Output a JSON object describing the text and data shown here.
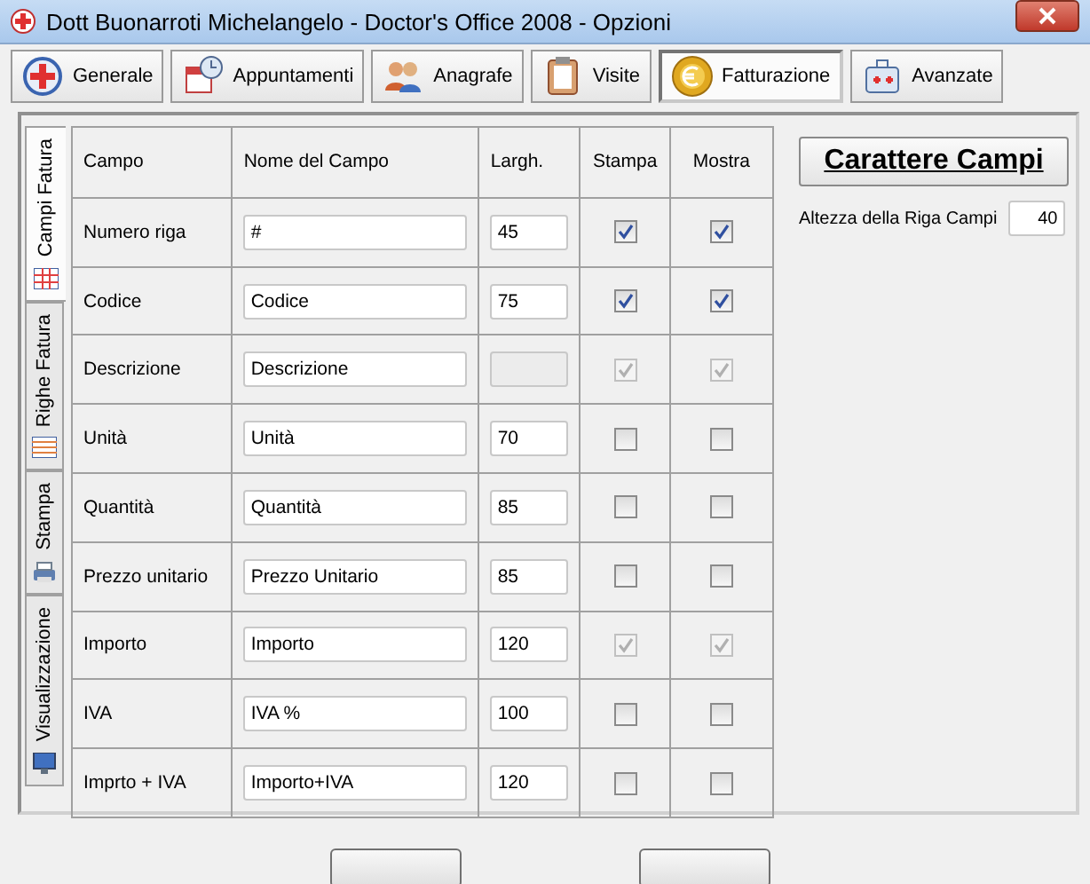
{
  "window": {
    "title": "Dott Buonarroti Michelangelo - Doctor's Office 2008 - Opzioni"
  },
  "toolbar": [
    {
      "label": "Generale",
      "selected": false
    },
    {
      "label": "Appuntamenti",
      "selected": false
    },
    {
      "label": "Anagrafe",
      "selected": false
    },
    {
      "label": "Visite",
      "selected": false
    },
    {
      "label": "Fatturazione",
      "selected": true
    },
    {
      "label": "Avanzate",
      "selected": false
    }
  ],
  "side_tabs": [
    {
      "label": "Campi Fatura",
      "selected": true
    },
    {
      "label": "Righe Fatura",
      "selected": false
    },
    {
      "label": "Stampa",
      "selected": false
    },
    {
      "label": "Visualizzazione",
      "selected": false
    }
  ],
  "table": {
    "columns": [
      "Campo",
      "Nome del Campo",
      "Largh.",
      "Stampa",
      "Mostra"
    ],
    "rows": [
      {
        "campo": "Numero riga",
        "nome": "#",
        "largh": "45",
        "largh_disabled": false,
        "stampa": true,
        "mostra": true,
        "disabled": false
      },
      {
        "campo": "Codice",
        "nome": "Codice",
        "largh": "75",
        "largh_disabled": false,
        "stampa": true,
        "mostra": true,
        "disabled": false
      },
      {
        "campo": "Descrizione",
        "nome": "Descrizione",
        "largh_disabled": true,
        "stampa": true,
        "mostra": true,
        "disabled": true
      },
      {
        "campo": "Unità",
        "nome": "Unità",
        "largh": "70",
        "largh_disabled": false,
        "stampa": false,
        "mostra": false,
        "disabled": false
      },
      {
        "campo": "Quantità",
        "nome": "Quantità",
        "largh": "85",
        "largh_disabled": false,
        "stampa": false,
        "mostra": false,
        "disabled": false
      },
      {
        "campo": "Prezzo unitario",
        "nome": "Prezzo Unitario",
        "largh": "85",
        "largh_disabled": false,
        "stampa": false,
        "mostra": false,
        "disabled": false
      },
      {
        "campo": "Importo",
        "nome": "Importo",
        "largh": "120",
        "largh_disabled": false,
        "stampa": true,
        "mostra": true,
        "disabled": true
      },
      {
        "campo": "IVA",
        "nome": "IVA %",
        "largh": "100",
        "largh_disabled": false,
        "stampa": false,
        "mostra": false,
        "disabled": false
      },
      {
        "campo": "Imprto + IVA",
        "nome": "Importo+IVA",
        "largh": "120",
        "largh_disabled": false,
        "stampa": false,
        "mostra": false,
        "disabled": false
      }
    ]
  },
  "font_button": "Carattere Campi",
  "row_height": {
    "label": "Altezza della Riga Campi",
    "value": "40"
  }
}
